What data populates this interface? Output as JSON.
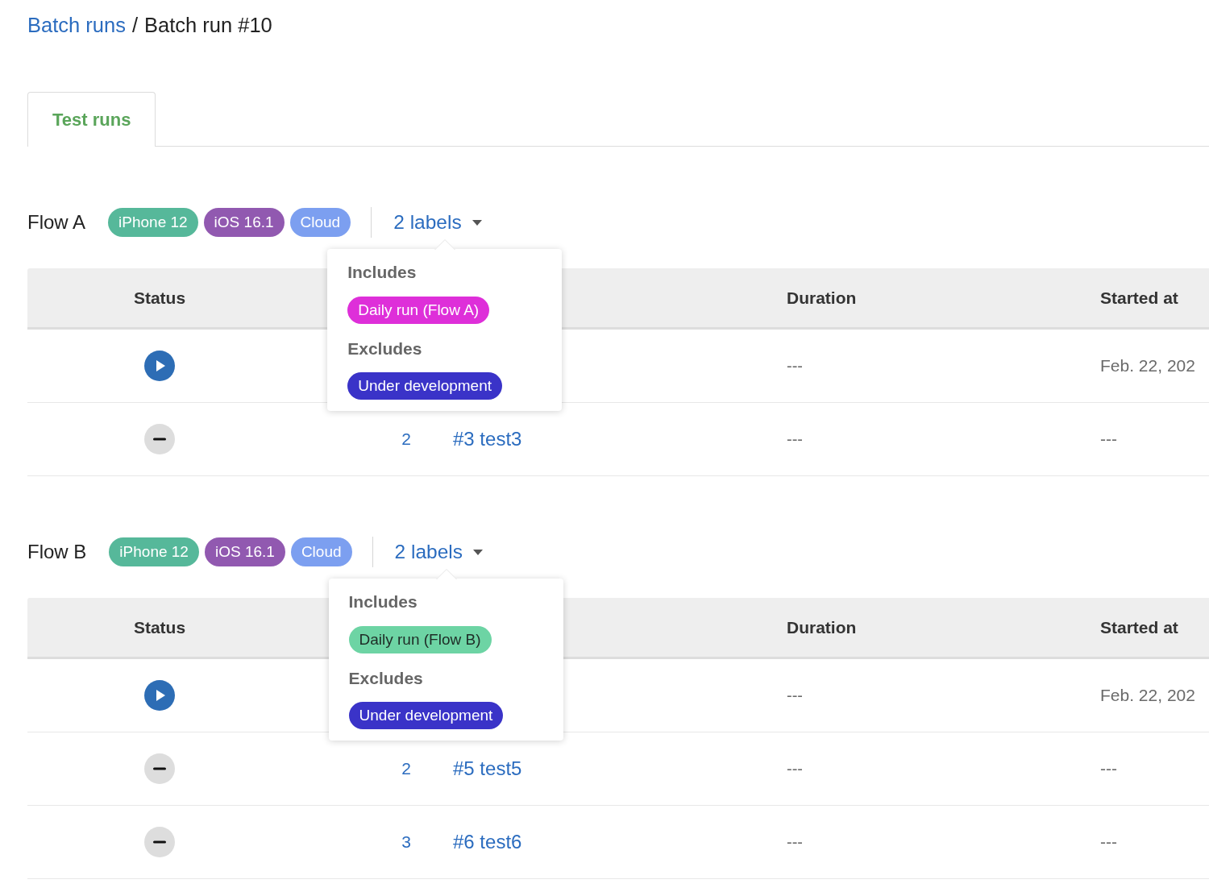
{
  "breadcrumb": [
    {
      "text": "Batch runs",
      "kind": "link"
    },
    {
      "text": "/",
      "kind": "separator"
    },
    {
      "text": "Batch run #10",
      "kind": "current"
    }
  ],
  "tabs": [
    {
      "label": "Test runs",
      "selected": true
    }
  ],
  "flows": [
    {
      "name": "Flow A",
      "tags": [
        {
          "text": "iPhone 12",
          "color": "#56b89a"
        },
        {
          "text": "iOS 16.1",
          "color": "#9159b0"
        },
        {
          "text": "Cloud",
          "color": "#7c9ff0"
        }
      ],
      "labels_dropdown": {
        "text": "2 labels",
        "expanded": true,
        "groups": [
          {
            "title": "Includes",
            "labels": [
              {
                "text": "Daily run (Flow A)",
                "color": "#de2fd9"
              }
            ]
          },
          {
            "title": "Excludes",
            "labels": [
              {
                "text": "Under development",
                "color": "#3a33c8"
              }
            ]
          }
        ]
      },
      "table": {
        "headings": {
          "status": "Status",
          "duration": "Duration",
          "started_at": "Started at"
        },
        "rows": [
          {
            "running": true,
            "duration": "---",
            "started_at": "Feb. 22, 202"
          },
          {
            "running": false,
            "column_2": "2",
            "column_3": "#3 test3",
            "duration": "---",
            "started_at": "---"
          }
        ]
      }
    },
    {
      "name": "Flow B",
      "tags": [
        {
          "text": "iPhone 12",
          "color": "#56b89a"
        },
        {
          "text": "iOS 16.1",
          "color": "#9159b0"
        },
        {
          "text": "Cloud",
          "color": "#7c9ff0"
        }
      ],
      "labels_dropdown": {
        "text": "2 labels",
        "expanded": true,
        "groups": [
          {
            "title": "Includes",
            "labels": [
              {
                "text": "Daily run (Flow B)",
                "color": "#6dd4a4"
              }
            ]
          },
          {
            "title": "Excludes",
            "labels": [
              {
                "text": "Under development",
                "color": "#3a33c8"
              }
            ]
          }
        ]
      },
      "table": {
        "headings": {
          "status": "Status",
          "duration": "Duration",
          "started_at": "Started at"
        },
        "rows": [
          {
            "running": true,
            "duration": "---",
            "started_at": "Feb. 22, 202"
          },
          {
            "running": false,
            "column_2": "2",
            "column_3": "#5 test5",
            "duration": "---",
            "started_at": "---"
          },
          {
            "running": false,
            "column_2": "3",
            "column_3": "#6 test6",
            "duration": "---",
            "started_at": "---"
          }
        ]
      }
    }
  ]
}
